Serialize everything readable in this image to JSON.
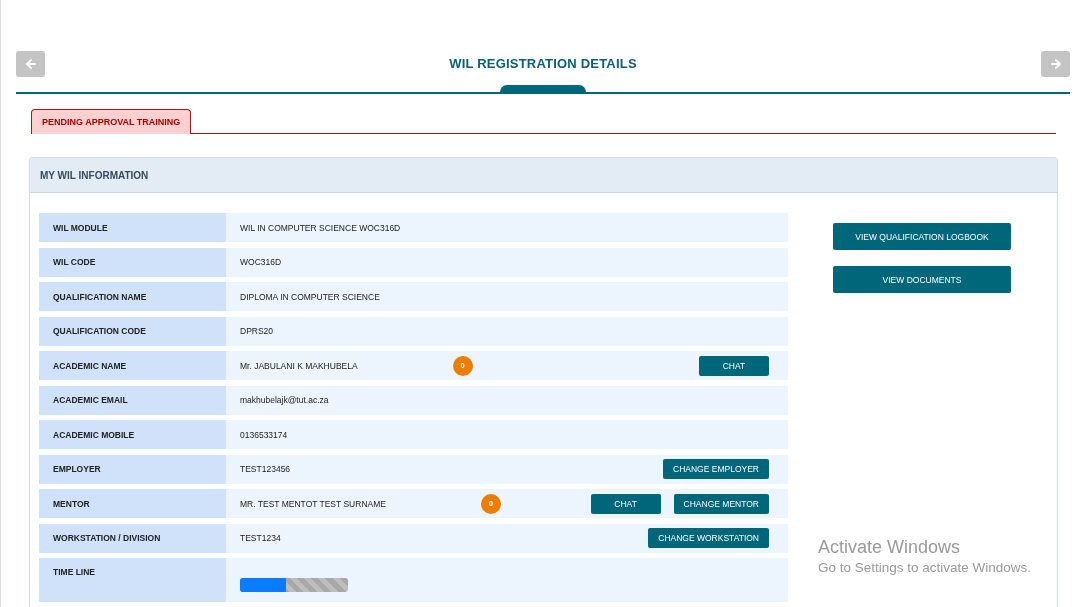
{
  "header": {
    "title": "WIL REGISTRATION DETAILS"
  },
  "tabs": [
    {
      "label": "PENDING APPROVAL TRAINING",
      "selected": true
    }
  ],
  "card": {
    "title": "MY WIL INFORMATION",
    "rows": [
      {
        "kind": "text",
        "label": "WIL MODULE",
        "value": "WIL IN COMPUTER SCIENCE WOC316D"
      },
      {
        "kind": "text",
        "label": "WIL CODE",
        "value": "WOC316D"
      },
      {
        "kind": "text",
        "label": "QUALIFICATION NAME",
        "value": "DIPLOMA IN COMPUTER SCIENCE"
      },
      {
        "kind": "text",
        "label": "QUALIFICATION CODE",
        "value": "DPRS20"
      },
      {
        "kind": "text",
        "label": "ACADEMIC NAME",
        "value": "Mr. JABULANI K MAKHUBELA",
        "badge": "0",
        "buttons": [
          "CHAT"
        ]
      },
      {
        "kind": "text",
        "label": "ACADEMIC EMAIL",
        "value": "makhubelajk@tut.ac.za"
      },
      {
        "kind": "text",
        "label": "ACADEMIC MOBILE",
        "value": "0136533174"
      },
      {
        "kind": "text",
        "label": "EMPLOYER",
        "value": "TEST123456",
        "buttons": [
          "CHANGE EMPLOYER"
        ]
      },
      {
        "kind": "text",
        "label": "MENTOR",
        "value": "MR. TEST MENTOT TEST SURNAME",
        "badge": "0",
        "buttons": [
          "CHAT",
          "CHANGE MENTOR"
        ]
      },
      {
        "kind": "text",
        "label": "WORKSTATION / DIVISION",
        "value": "TEST1234",
        "buttons": [
          "CHANGE WORKSTATION"
        ]
      },
      {
        "kind": "timeline",
        "label": "TIME LINE",
        "level": 0.43
      }
    ],
    "side_buttons": [
      "VIEW QUALIFICATION LOGBOOK",
      "VIEW DOCUMENTS"
    ]
  },
  "os_notice": {
    "title": "Activate Windows",
    "text": "Go to Settings to activate Windows."
  }
}
